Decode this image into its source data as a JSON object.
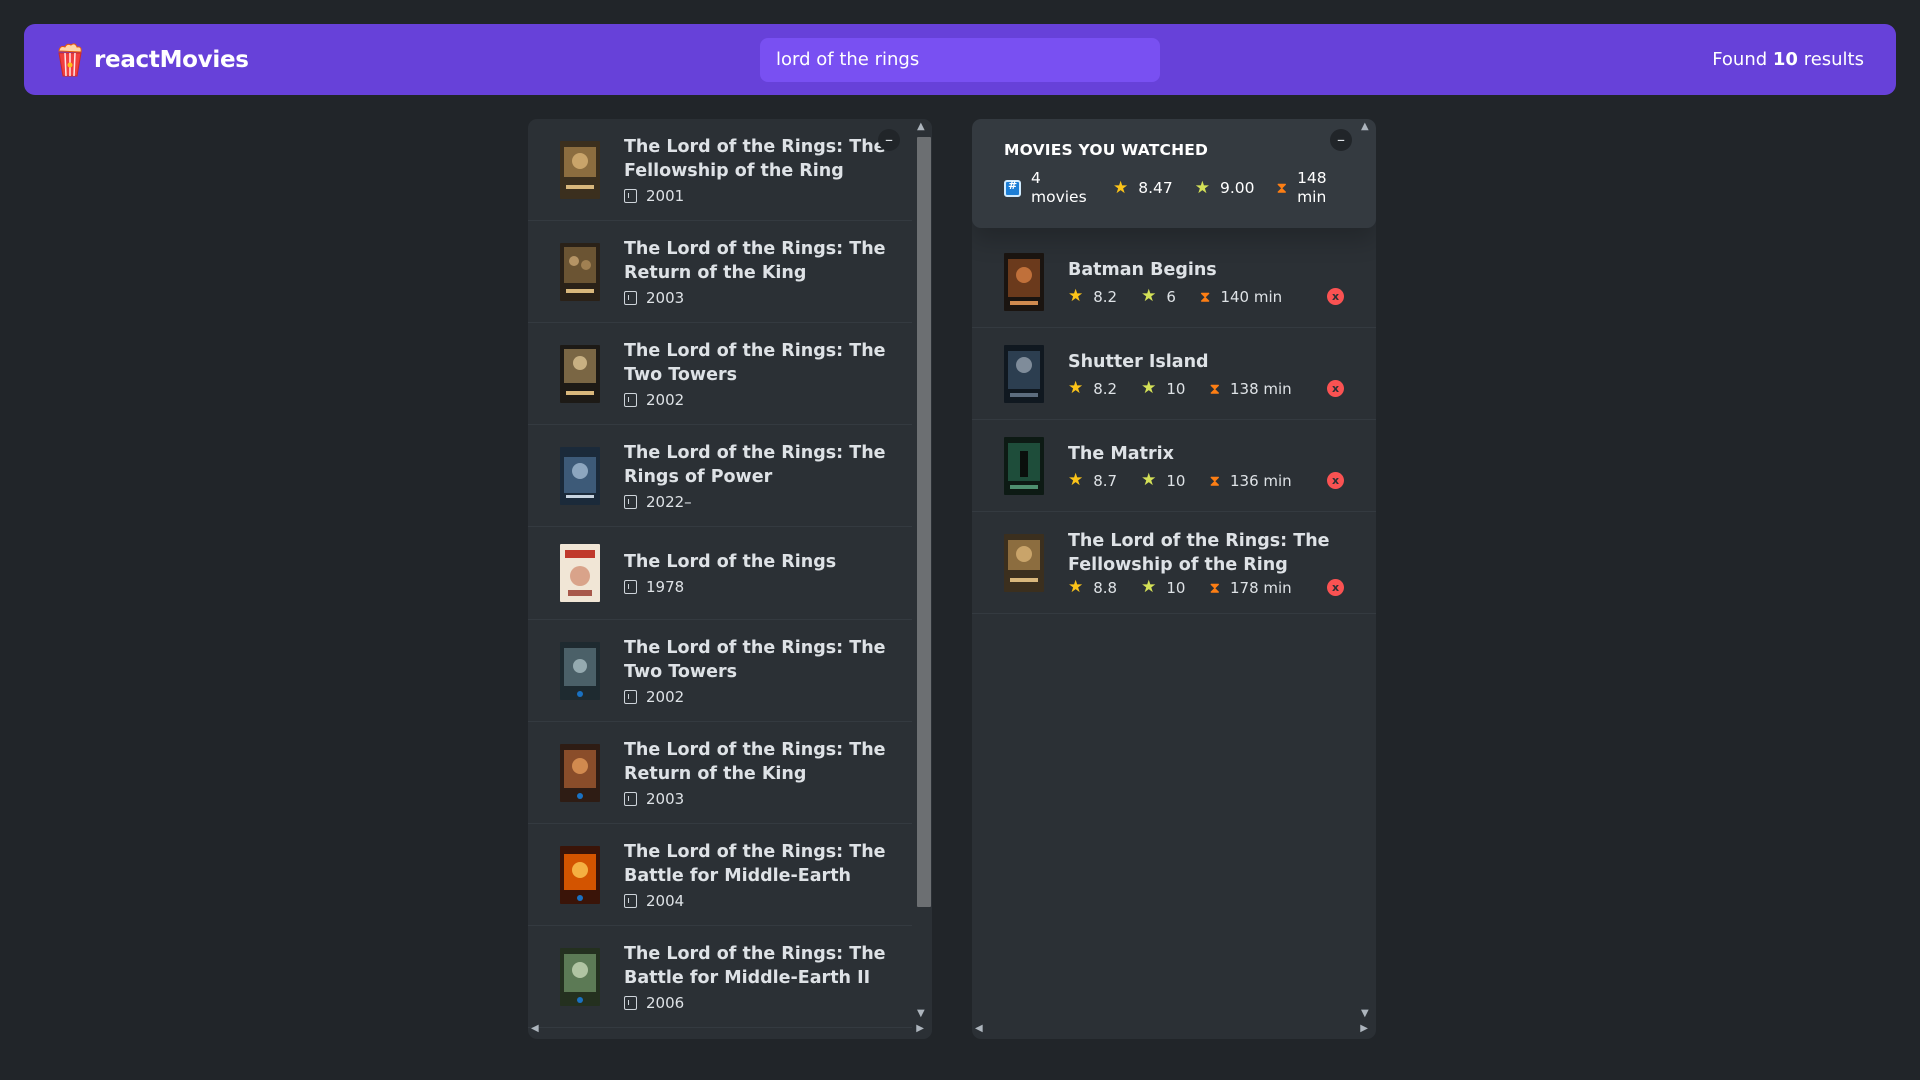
{
  "nav": {
    "logo_text": "reactMovies",
    "search_value": "lord of the rings",
    "results_prefix": "Found",
    "results_count": "10",
    "results_suffix": "results"
  },
  "colors": {
    "primary": "#6741d9",
    "primary_light": "#7950f2",
    "background": "#212529",
    "box_bg": "#2b3035",
    "star": "#fcc419",
    "delete": "#fa5252"
  },
  "search_results": [
    {
      "title": "The Lord of the Rings: The Fellowship of the Ring",
      "year": "2001"
    },
    {
      "title": "The Lord of the Rings: The Return of the King",
      "year": "2003"
    },
    {
      "title": "The Lord of the Rings: The Two Towers",
      "year": "2002"
    },
    {
      "title": "The Lord of the Rings: The Rings of Power",
      "year": "2022–"
    },
    {
      "title": "The Lord of the Rings",
      "year": "1978"
    },
    {
      "title": "The Lord of the Rings: The Two Towers",
      "year": "2002"
    },
    {
      "title": "The Lord of the Rings: The Return of the King",
      "year": "2003"
    },
    {
      "title": "The Lord of the Rings: The Battle for Middle-Earth",
      "year": "2004"
    },
    {
      "title": "The Lord of the Rings: The Battle for Middle-Earth II",
      "year": "2006"
    }
  ],
  "summary": {
    "title": "Movies you watched",
    "movies_count": "4",
    "movies_unit": "movies",
    "avg_imdb": "8.47",
    "avg_user": "9.00",
    "avg_runtime": "148",
    "runtime_unit": "min"
  },
  "watched": [
    {
      "title": "Batman Begins",
      "imdb": "8.2",
      "user": "6",
      "runtime": "140 min"
    },
    {
      "title": "Shutter Island",
      "imdb": "8.2",
      "user": "10",
      "runtime": "138 min"
    },
    {
      "title": "The Matrix",
      "imdb": "8.7",
      "user": "10",
      "runtime": "136 min"
    },
    {
      "title": "The Lord of the Rings: The Fellowship of the Ring",
      "imdb": "8.8",
      "user": "10",
      "runtime": "178 min"
    }
  ],
  "toggle_label": "–",
  "delete_label": "x"
}
